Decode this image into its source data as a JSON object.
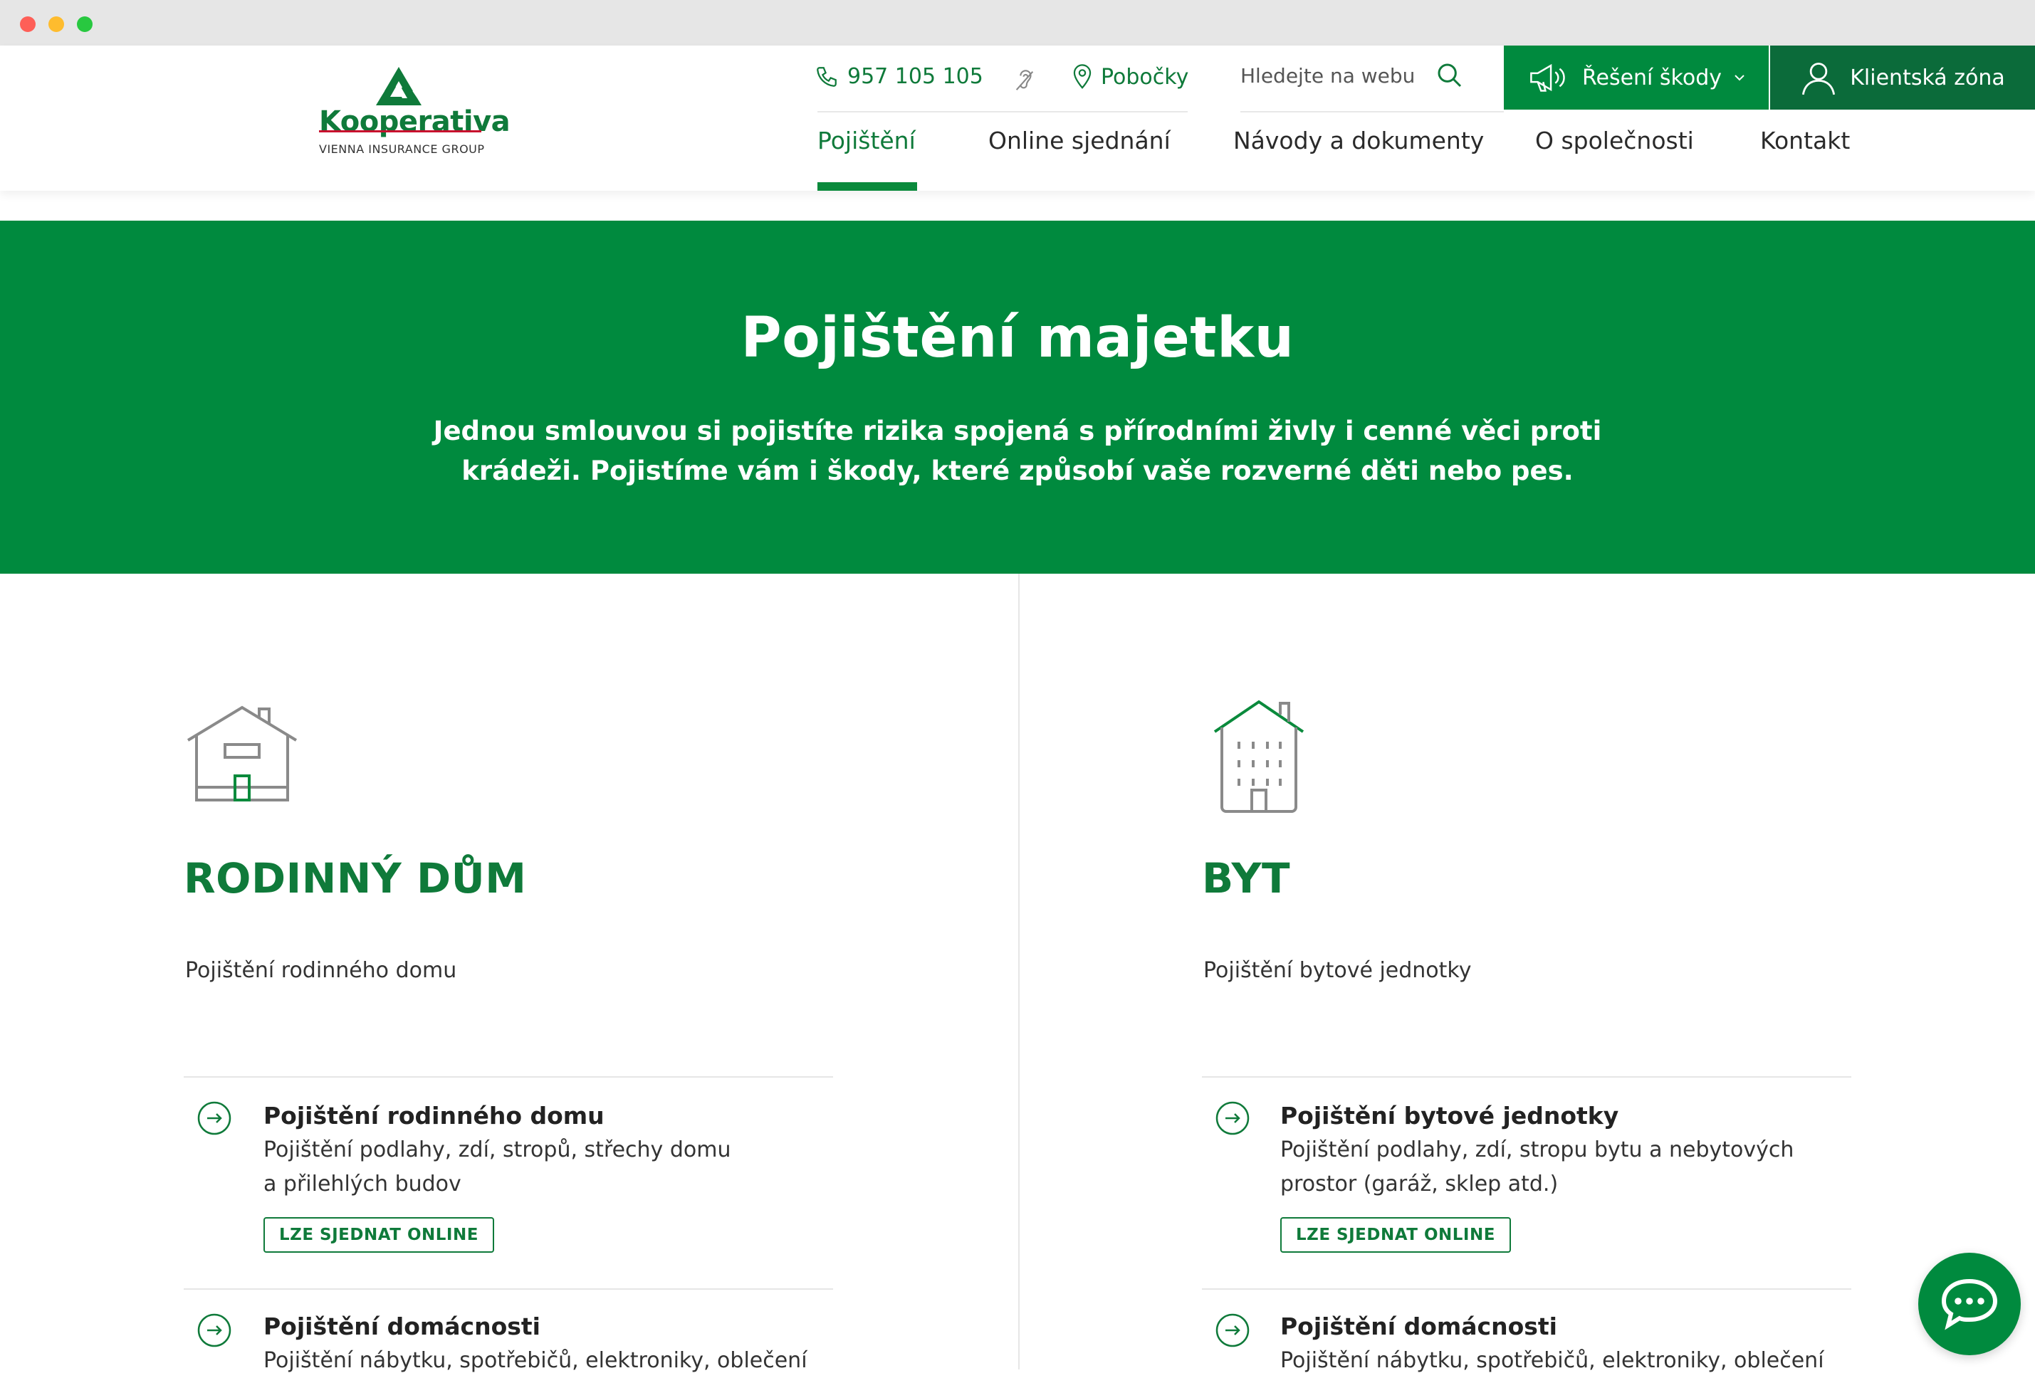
{
  "brand": {
    "name": "Kooperativa",
    "tagline": "VIENNA INSURANCE GROUP",
    "color_primary": "#008a3e",
    "color_dark": "#0b6b3a",
    "color_logo_red": "#c8102e"
  },
  "topbar": {
    "phone": "957 105 105",
    "branches": "Pobočky",
    "search_placeholder": "Hledejte na webu",
    "claims_button": "Řešení škody",
    "client_zone_button": "Klientská zóna"
  },
  "nav": {
    "items": [
      "Pojištění",
      "Online sjednání",
      "Návody a dokumenty",
      "O společnosti",
      "Kontakt"
    ]
  },
  "hero": {
    "title": "Pojištění majetku",
    "text": "Jednou smlouvou si pojistíte rizika spojená s přírodními živly i cenné věci proti krádeži. Pojistíme vám i škody, které způsobí vaše rozverné děti nebo pes."
  },
  "columns": [
    {
      "icon": "house-icon",
      "title": "RODINNÝ DŮM",
      "subtitle": "Pojištění rodinného domu",
      "items": [
        {
          "title": "Pojištění rodinného domu",
          "desc_line1": "Pojištění podlahy, zdí, stropů, střechy domu",
          "desc_line2": "a přilehlých budov",
          "badge": "LZE SJEDNAT ONLINE"
        },
        {
          "title": "Pojištění domácnosti",
          "desc_line1": "Pojištění nábytku, spotřebičů, elektroniky, oblečení"
        }
      ]
    },
    {
      "icon": "apartment-building-icon",
      "title": "BYT",
      "subtitle": "Pojištění bytové jednotky",
      "items": [
        {
          "title": "Pojištění bytové jednotky",
          "desc_line1": "Pojištění podlahy, zdí, stropu bytu a nebytových",
          "desc_line2": "prostor (garáž, sklep atd.)",
          "badge": "LZE SJEDNAT ONLINE"
        },
        {
          "title": "Pojištění domácnosti",
          "desc_line1": "Pojištění nábytku, spotřebičů, elektroniky, oblečení"
        }
      ]
    }
  ],
  "chat": {
    "icon": "chat-bubble-icon"
  }
}
